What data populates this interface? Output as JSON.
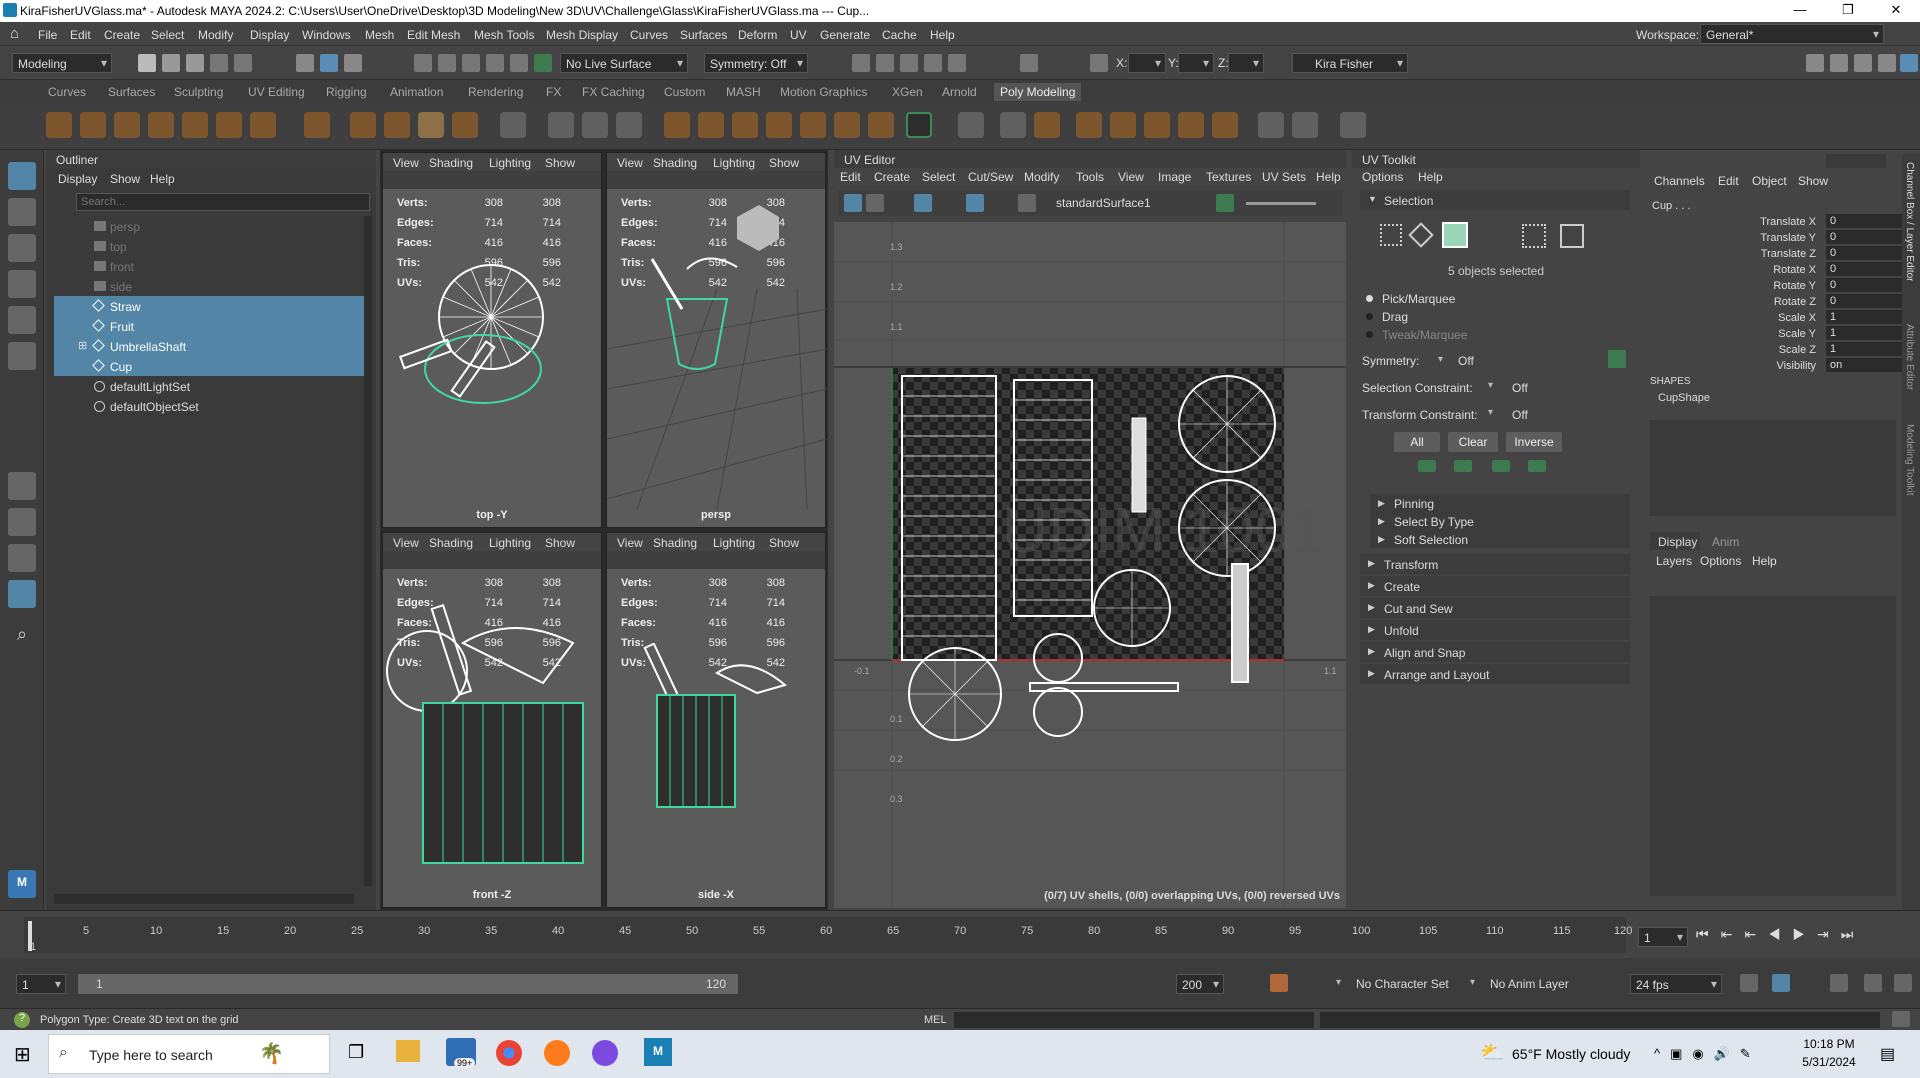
{
  "window": {
    "title": "KiraFisherUVGlass.ma* - Autodesk MAYA 2024.2: C:\\Users\\User\\OneDrive\\Desktop\\3D Modeling\\New 3D\\UV\\Challenge\\Glass\\KiraFisherUVGlass.ma  ---  Cup...",
    "minimize": "—",
    "maximize": "❐",
    "close": "✕"
  },
  "menubar": {
    "items": [
      "File",
      "Edit",
      "Create",
      "Select",
      "Modify",
      "Display",
      "Windows",
      "Mesh",
      "Edit Mesh",
      "Mesh Tools",
      "Mesh Display",
      "Curves",
      "Surfaces",
      "Deform",
      "UV",
      "Generate",
      "Cache",
      "Help"
    ],
    "workspace_label": "Workspace:",
    "workspace_value": "General*"
  },
  "statusline": {
    "mode": "Modeling",
    "live_surface": "No Live Surface",
    "symmetry": "Symmetry: Off",
    "x_label": "X:",
    "y_label": "Y:",
    "z_label": "Z:",
    "user": "Kira Fisher"
  },
  "shelf": {
    "tabs": [
      "Curves",
      "Surfaces",
      "Sculpting",
      "UV Editing",
      "Rigging",
      "Animation",
      "Rendering",
      "FX",
      "FX Caching",
      "Custom",
      "MASH",
      "Motion Graphics",
      "XGen",
      "Arnold",
      "Poly Modeling"
    ],
    "active": "Poly Modeling"
  },
  "outliner": {
    "title": "Outliner",
    "menu": [
      "Display",
      "Show",
      "Help"
    ],
    "search_placeholder": "Search...",
    "items": [
      {
        "label": "persp",
        "state": "dim"
      },
      {
        "label": "top",
        "state": "dim"
      },
      {
        "label": "front",
        "state": "dim"
      },
      {
        "label": "side",
        "state": "dim"
      },
      {
        "label": "Straw",
        "state": "sel"
      },
      {
        "label": "Fruit",
        "state": "sel"
      },
      {
        "label": "UmbrellaShaft",
        "state": "sel"
      },
      {
        "label": "Cup",
        "state": "sel"
      },
      {
        "label": "defaultLightSet",
        "state": "normal"
      },
      {
        "label": "defaultObjectSet",
        "state": "normal"
      }
    ]
  },
  "viewports": {
    "menu": [
      "View",
      "Shading",
      "Lighting",
      "Show"
    ],
    "hud_labels": [
      "Verts:",
      "Edges:",
      "Faces:",
      "Tris:",
      "UVs:"
    ],
    "hud_values_a": [
      "308",
      "714",
      "416",
      "596",
      "542"
    ],
    "hud_values_b": [
      "308",
      "714",
      "416",
      "596",
      "542"
    ],
    "labels": [
      "top -Y",
      "persp",
      "front -Z",
      "side -X"
    ]
  },
  "uv_editor": {
    "title": "UV Editor",
    "menu": [
      "Edit",
      "Create",
      "Select",
      "Cut/Sew",
      "Modify",
      "Tools",
      "View",
      "Image",
      "Textures",
      "UV Sets",
      "Help"
    ],
    "texture": "standardSurface1",
    "status": "(0/7) UV shells, (0/0) overlapping UVs, (0/0) reversed UVs",
    "axis_labels": [
      "1.3",
      "1.2",
      "1.1",
      "0.1",
      "0.2",
      "0.3",
      "-0.1",
      "1.1"
    ]
  },
  "uv_toolkit": {
    "title": "UV Toolkit",
    "menu": [
      "Options",
      "Help"
    ],
    "selection_header": "Selection",
    "objects_selected": "5 objects selected",
    "pick_modes": [
      "Pick/Marquee",
      "Drag",
      "Tweak/Marquee"
    ],
    "symmetry_label": "Symmetry:",
    "symmetry_value": "Off",
    "selection_constraint_label": "Selection Constraint:",
    "selection_constraint_value": "Off",
    "transform_constraint_label": "Transform Constraint:",
    "transform_constraint_value": "Off",
    "buttons": [
      "All",
      "Clear",
      "Inverse"
    ],
    "subsections": [
      "Pinning",
      "Select By Type",
      "Soft Selection"
    ],
    "sections": [
      "Transform",
      "Create",
      "Cut and Sew",
      "Unfold",
      "Align and Snap",
      "Arrange and Layout"
    ]
  },
  "channel_box": {
    "menu": [
      "Channels",
      "Edit",
      "Object",
      "Show"
    ],
    "object": "Cup . . .",
    "attrs": [
      {
        "name": "Translate X",
        "value": "0"
      },
      {
        "name": "Translate Y",
        "value": "0"
      },
      {
        "name": "Translate Z",
        "value": "0"
      },
      {
        "name": "Rotate X",
        "value": "0"
      },
      {
        "name": "Rotate Y",
        "value": "0"
      },
      {
        "name": "Rotate Z",
        "value": "0"
      },
      {
        "name": "Scale X",
        "value": "1"
      },
      {
        "name": "Scale Y",
        "value": "1"
      },
      {
        "name": "Scale Z",
        "value": "1"
      },
      {
        "name": "Visibility",
        "value": "on"
      }
    ],
    "shapes_header": "SHAPES",
    "shape": "CupShape",
    "layer_tabs": [
      "Display",
      "Anim"
    ],
    "layer_menu": [
      "Layers",
      "Options",
      "Help"
    ],
    "side_tabs": [
      "Channel Box / Layer Editor",
      "Attribute Editor",
      "Modeling Toolkit"
    ]
  },
  "time_slider": {
    "ticks": [
      "5",
      "10",
      "15",
      "20",
      "25",
      "30",
      "35",
      "40",
      "45",
      "50",
      "55",
      "60",
      "65",
      "70",
      "75",
      "80",
      "85",
      "90",
      "95",
      "100",
      "105",
      "110",
      "115",
      "120"
    ],
    "current_frame": "1",
    "current_field": "1"
  },
  "range_slider": {
    "start": "1",
    "inner_start": "1",
    "inner_end": "120",
    "end": "200",
    "character_set": "No Character Set",
    "anim_layer": "No Anim Layer",
    "fps": "24 fps"
  },
  "cmdline": {
    "help": "Polygon Type: Create 3D text on the grid",
    "mel": "MEL"
  },
  "taskbar": {
    "search_placeholder": "Type here to search",
    "weather": "65°F  Mostly cloudy",
    "time": "10:18 PM",
    "date": "5/31/2024",
    "mail_badge": "99+"
  }
}
